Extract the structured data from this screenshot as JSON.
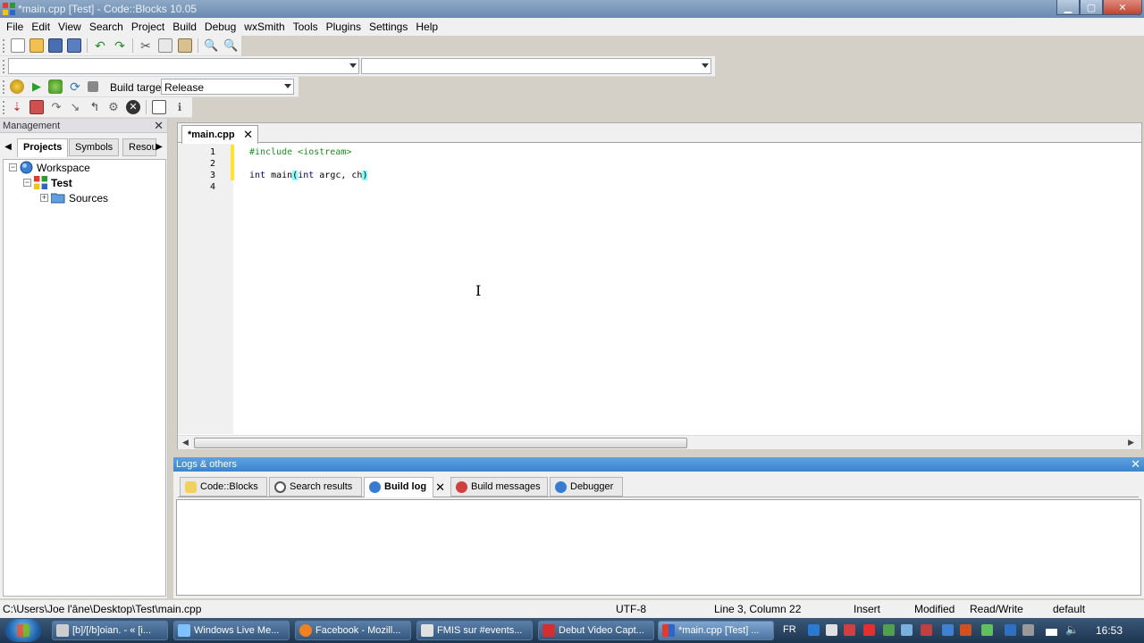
{
  "window": {
    "title": "*main.cpp [Test] - Code::Blocks 10.05"
  },
  "menu": [
    "File",
    "Edit",
    "View",
    "Search",
    "Project",
    "Build",
    "Debug",
    "wxSmith",
    "Tools",
    "Plugins",
    "Settings",
    "Help"
  ],
  "toolbar": {
    "build_target_label": "Build target:",
    "build_target_value": "Release"
  },
  "management": {
    "title": "Management",
    "tabs": [
      "Projects",
      "Symbols",
      "Resou"
    ],
    "tree": {
      "workspace": "Workspace",
      "project": "Test",
      "folder": "Sources"
    }
  },
  "editor": {
    "tab": "*main.cpp",
    "lines": [
      "1",
      "2",
      "3",
      "4"
    ],
    "code": {
      "line1": "#include <iostream>",
      "line3_a": "int",
      "line3_b": " main",
      "line3_c": "(",
      "line3_d": "int",
      "line3_e": " argc, ch",
      "line3_f": ")"
    }
  },
  "logs": {
    "title": "Logs & others",
    "tabs": [
      "Code::Blocks",
      "Search results",
      "Build log",
      "Build messages",
      "Debugger"
    ]
  },
  "status": {
    "path": "C:\\Users\\Joe l'âne\\Desktop\\Test\\main.cpp",
    "encoding": "UTF-8",
    "position": "Line 3, Column 22",
    "mode": "Insert",
    "modified": "Modified",
    "access": "Read/Write",
    "lang": "default"
  },
  "taskbar": {
    "tasks": [
      "[b]/[/b]oian. - « [i...",
      "Windows Live Me...",
      "Facebook - Mozill...",
      "FMIS sur #events...",
      "Debut Video Capt...",
      "*main.cpp [Test] ..."
    ],
    "lang": "FR",
    "time": "16:53"
  }
}
